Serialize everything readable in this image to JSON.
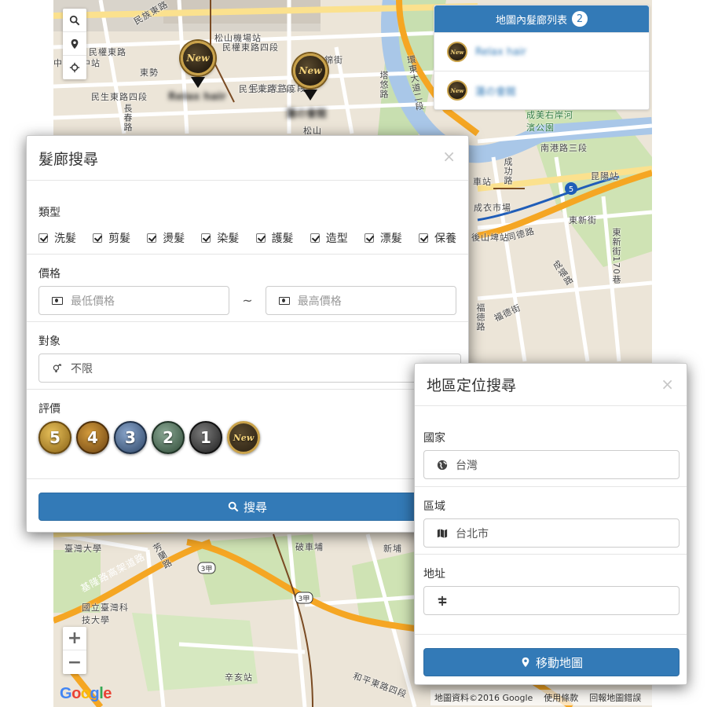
{
  "map": {
    "streets": [
      {
        "id": "s1",
        "text": "民族東路"
      },
      {
        "id": "s2",
        "text": "松山機場站"
      },
      {
        "id": "s3",
        "text": "民權東路四段"
      },
      {
        "id": "s4",
        "text": "民權東路"
      },
      {
        "id": "s5",
        "text": "中山國中站"
      },
      {
        "id": "s6",
        "text": "東勢"
      },
      {
        "id": "s7",
        "text": "民生東路五段"
      },
      {
        "id": "s8",
        "text": "民生東路四段"
      },
      {
        "id": "s9",
        "text": "錦街"
      },
      {
        "id": "s10",
        "text": "塔悠路"
      },
      {
        "id": "s11",
        "text": "環東大道二段"
      },
      {
        "id": "s12",
        "text": "成美右岸河濱公園"
      },
      {
        "id": "s13",
        "text": "南港路三段"
      },
      {
        "id": "s14",
        "text": "昆陽站"
      },
      {
        "id": "s15",
        "text": "東新街"
      },
      {
        "id": "s16",
        "text": "同德路"
      },
      {
        "id": "s17",
        "text": "後山埤站"
      },
      {
        "id": "s18",
        "text": "福德街"
      },
      {
        "id": "s19",
        "text": "成福路"
      },
      {
        "id": "s20",
        "text": "東新街170巷"
      },
      {
        "id": "s21",
        "text": "基隆路高架道路"
      },
      {
        "id": "s22",
        "text": "國立臺灣科技大學"
      },
      {
        "id": "s23",
        "text": "辛亥站"
      },
      {
        "id": "s24",
        "text": "和平東路四段"
      },
      {
        "id": "s25",
        "text": "民生東路三段"
      },
      {
        "id": "s26",
        "text": "松山"
      },
      {
        "id": "s27",
        "text": "成衣市場"
      },
      {
        "id": "s28",
        "text": "車站"
      },
      {
        "id": "s29",
        "text": "臺灣大學"
      },
      {
        "id": "s30",
        "text": "芳蘭路"
      },
      {
        "id": "s31",
        "text": "破車埔"
      },
      {
        "id": "s32",
        "text": "新埔"
      },
      {
        "id": "s33",
        "text": "長春路"
      },
      {
        "id": "s34",
        "text": "福德路"
      },
      {
        "id": "s35",
        "text": "成功路"
      }
    ],
    "markers": [
      {
        "label": "New",
        "name": "Relax hair"
      },
      {
        "label": "New",
        "name": "蓮の會館"
      }
    ],
    "footer": {
      "data": "地圖資料©2016 Google",
      "terms": "使用條款",
      "report": "回報地圖錯誤"
    },
    "logo": "Google",
    "zoom_in": "+",
    "zoom_out": "−",
    "highway_shields": [
      "5",
      "3甲",
      "3甲"
    ]
  },
  "list_panel": {
    "title": "地圖內髮廊列表",
    "count": "2",
    "items": [
      {
        "badge": "New",
        "name": "Relax hair"
      },
      {
        "badge": "New",
        "name": "蓮の會館"
      }
    ]
  },
  "salon_search": {
    "title": "髮廊搜尋",
    "close": "×",
    "type_label": "類型",
    "types": [
      "洗髮",
      "剪髮",
      "燙髮",
      "染髮",
      "護髮",
      "造型",
      "漂髮",
      "保養"
    ],
    "price_label": "價格",
    "min_placeholder": "最低價格",
    "tilde": "~",
    "max_placeholder": "最高價格",
    "target_label": "對象",
    "target_value": "不限",
    "rating_label": "評價",
    "ratings": [
      {
        "text": "5",
        "color": "#c99a2e"
      },
      {
        "text": "4",
        "color": "#b07a26"
      },
      {
        "text": "3",
        "color": "#4c6a94"
      },
      {
        "text": "2",
        "color": "#4e6b57"
      },
      {
        "text": "1",
        "color": "#3a3a3a"
      },
      {
        "text": "New",
        "color": "#3a2d18"
      }
    ],
    "search_button": "搜尋"
  },
  "location_search": {
    "title": "地區定位搜尋",
    "close": "×",
    "country_label": "國家",
    "country_value": "台灣",
    "region_label": "區域",
    "region_value": "台北市",
    "address_label": "地址",
    "address_value": "",
    "move_button": "移動地圖"
  },
  "colors": {
    "primary": "#337ab7",
    "map_bg": "#ece5d8",
    "highway": "#f5a623"
  }
}
